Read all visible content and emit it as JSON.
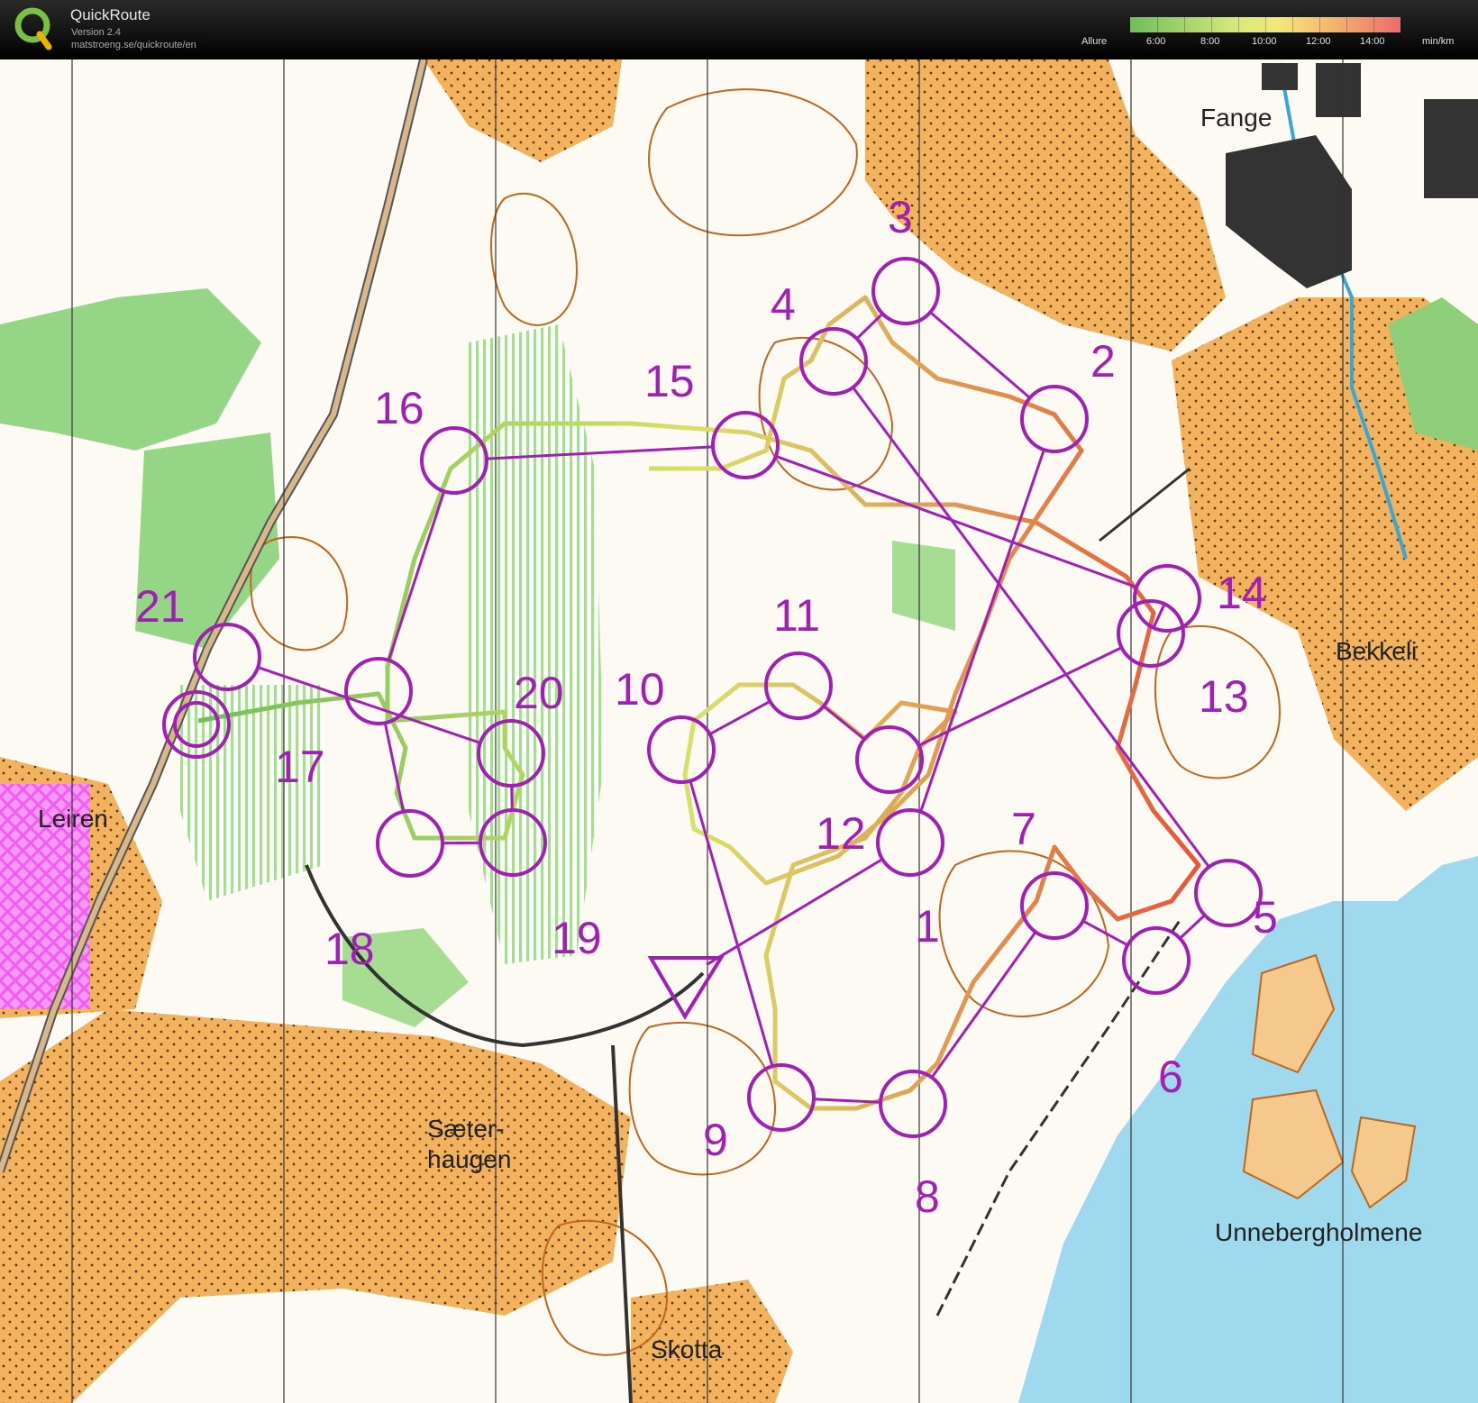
{
  "app": {
    "title": "QuickRoute",
    "version": "Version 2.4",
    "url": "matstroeng.se/quickroute/en"
  },
  "legend": {
    "label": "Allure",
    "ticks": [
      "6:00",
      "8:00",
      "10:00",
      "12:00",
      "14:00"
    ],
    "unit": "min/km"
  },
  "colors": {
    "course": "#a21fb5",
    "water": "#9fd9ee",
    "open_land": "#f5b25a",
    "forest": "#ffffff",
    "green": "#8fd47a",
    "contour": "#c0661f",
    "route_slow": "#e8443a",
    "route_fast": "#6fbf5a"
  },
  "controls": [
    {
      "label": "1"
    },
    {
      "label": "2"
    },
    {
      "label": "3"
    },
    {
      "label": "4"
    },
    {
      "label": "5"
    },
    {
      "label": "6"
    },
    {
      "label": "7"
    },
    {
      "label": "8"
    },
    {
      "label": "9"
    },
    {
      "label": "10"
    },
    {
      "label": "11"
    },
    {
      "label": "12"
    },
    {
      "label": "13"
    },
    {
      "label": "14"
    },
    {
      "label": "15"
    },
    {
      "label": "16"
    },
    {
      "label": "17"
    },
    {
      "label": "18"
    },
    {
      "label": "19"
    },
    {
      "label": "20"
    },
    {
      "label": "21"
    }
  ],
  "places": {
    "fange": "Fange",
    "bekkeli": "Bekkeli",
    "leiren": "Leiren",
    "saeter_1": "Sæter-",
    "saeter_2": "haugen",
    "skotta": "Skotta",
    "unneberg": "Unnebergholmene"
  }
}
